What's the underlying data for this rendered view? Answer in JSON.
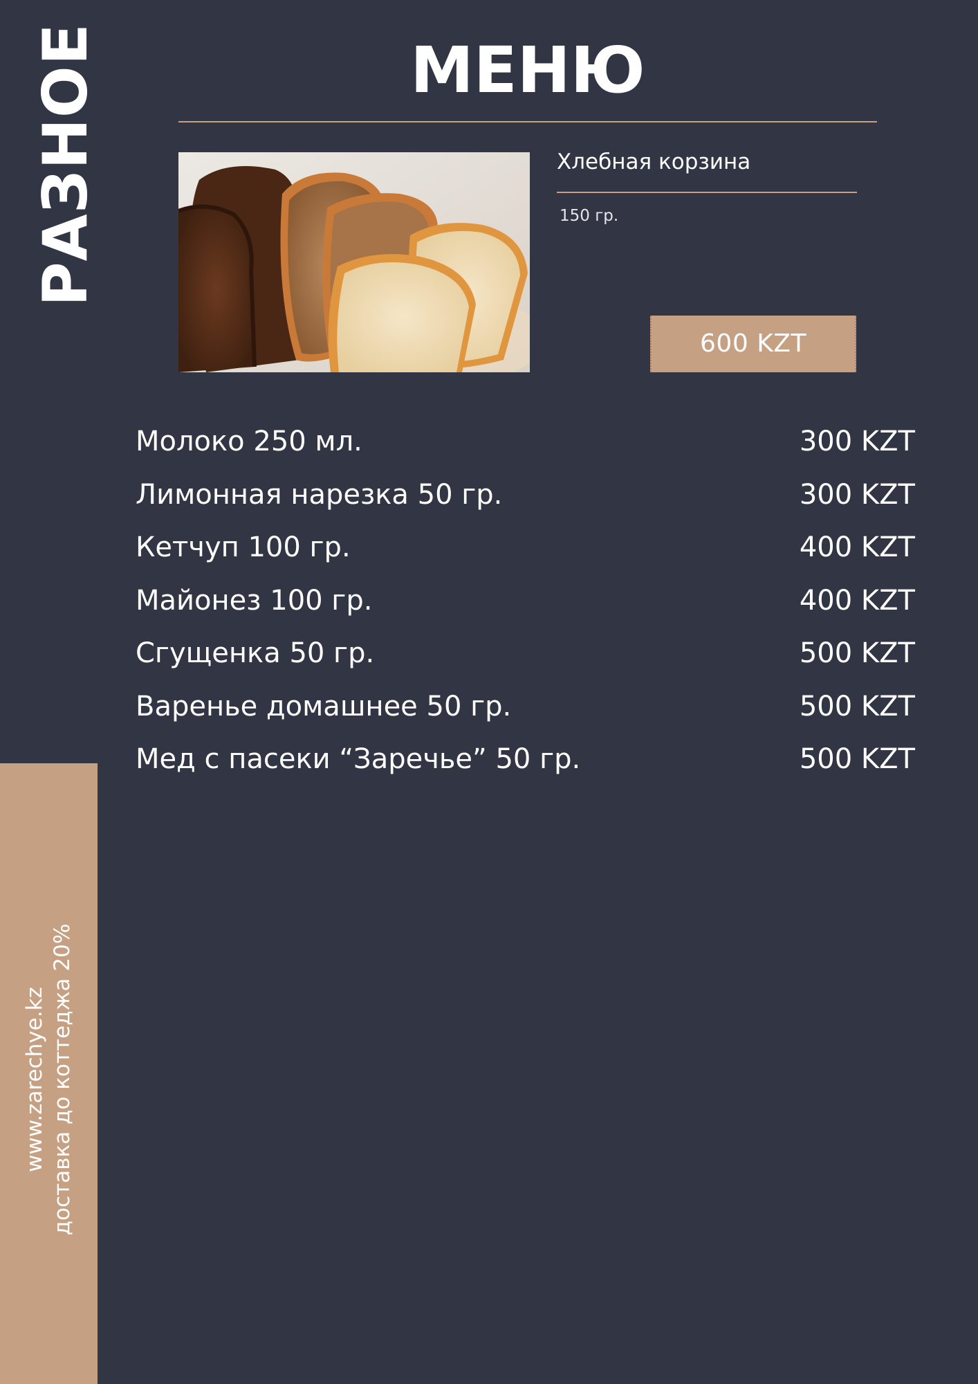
{
  "colors": {
    "background": "#313544",
    "accent": "#c6a083",
    "text": "#ffffff"
  },
  "section_title": "РАЗНОЕ",
  "menu_title": "МЕНЮ",
  "featured": {
    "image": "bread-slices-photo",
    "name": "Хлебная корзина",
    "weight": "150 гр.",
    "price": "600 KZT"
  },
  "items": [
    {
      "name": "Молоко 250 мл.",
      "price": "300 KZT"
    },
    {
      "name": "Лимонная нарезка 50 гр.",
      "price": "300 KZT"
    },
    {
      "name": "Кетчуп 100 гр.",
      "price": "400 KZT"
    },
    {
      "name": "Майонез 100 гр.",
      "price": "400 KZT"
    },
    {
      "name": "Сгущенка 50 гр.",
      "price": "500 KZT"
    },
    {
      "name": "Варенье домашнее 50 гр.",
      "price": "500 KZT"
    },
    {
      "name": "Мед с пасеки “Заречье” 50 гр.",
      "price": "500 KZT"
    }
  ],
  "footer": {
    "website": "www.zarechye.kz",
    "delivery": "доставка до коттеджа 20%"
  }
}
